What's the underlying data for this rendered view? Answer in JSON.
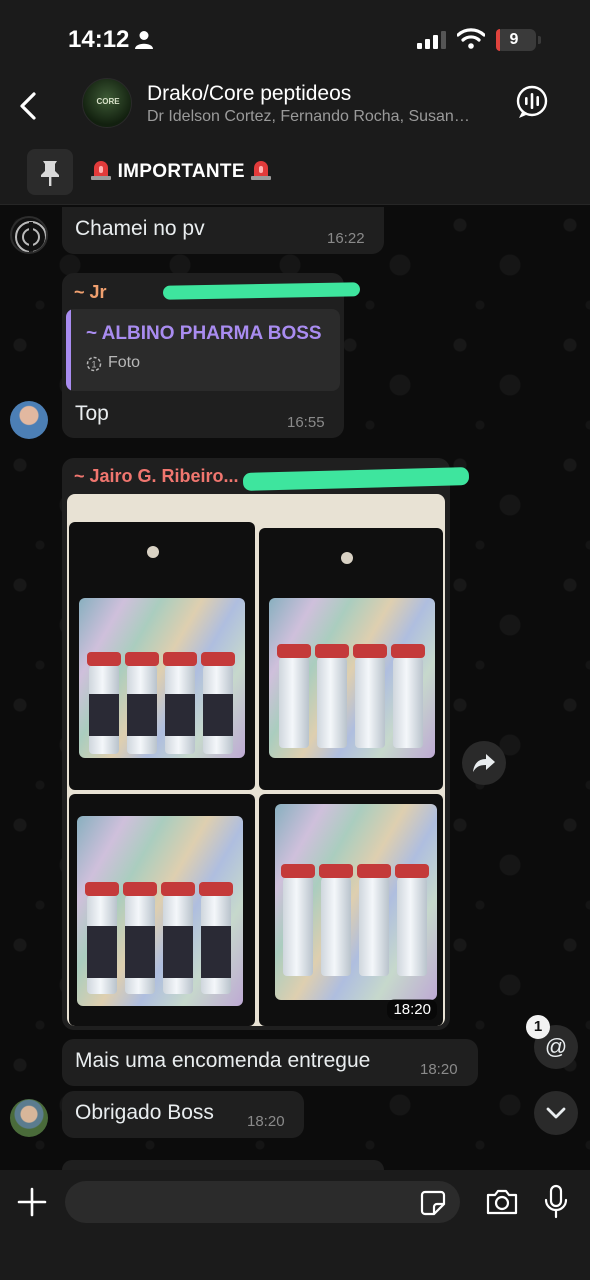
{
  "status_bar": {
    "time": "14:12",
    "battery": "9",
    "battery_fraction": 0.09
  },
  "header": {
    "title": "Drako/Core peptideos",
    "subtitle": "Dr Idelson Cortez, Fernando Rocha, Susan…",
    "avatar_text": "CORE"
  },
  "pinned": {
    "text": "IMPORTANTE"
  },
  "messages": [
    {
      "text": "Chamei no pv",
      "time": "16:22"
    },
    {
      "sender": "~ Jr",
      "quote_name": "~ ALBINO PHARMA BOSS",
      "quote_type": "Foto",
      "text": "Top",
      "time": "16:55"
    },
    {
      "sender": "~ Jairo G. Ribeiro...",
      "photo_time": "18:20"
    },
    {
      "text": "Mais uma encomenda entregue",
      "time": "18:20"
    },
    {
      "text": "Obrigado Boss",
      "time": "18:20"
    }
  ],
  "mentions": {
    "count": "1",
    "symbol": "@"
  },
  "composer": {
    "placeholder": ""
  },
  "colors": {
    "accent_purple": "#a98cf0",
    "sender_red": "#f0766f",
    "highlight_green": "#3ee59e",
    "background": "#0b0b0b"
  }
}
